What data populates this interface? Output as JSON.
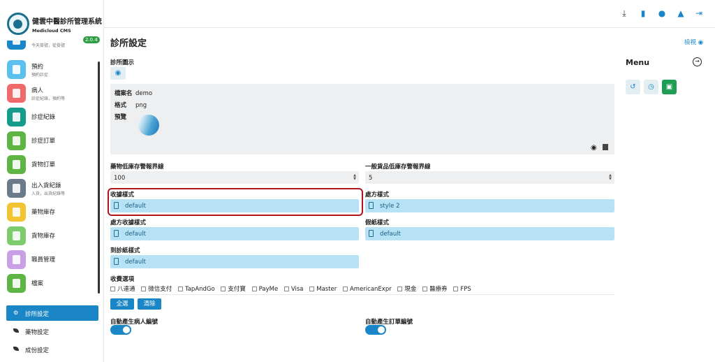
{
  "app": {
    "title": "健雲中醫診所管理系統",
    "subtitle": "Medicloud CMS",
    "version": "2.0.4"
  },
  "sidebar": {
    "items": [
      {
        "label": "",
        "sub": "今天掛號，從掛號",
        "color": "#1b86c7"
      },
      {
        "label": "預約",
        "sub": "預約診症",
        "color": "#5cc0ee"
      },
      {
        "label": "病人",
        "sub": "診症紀錄，預約等",
        "color": "#ef6b6b"
      },
      {
        "label": "診症紀錄",
        "sub": "",
        "color": "#159c8a"
      },
      {
        "label": "診症訂單",
        "sub": "",
        "color": "#5fb544"
      },
      {
        "label": "貨物訂單",
        "sub": "",
        "color": "#5fb544"
      },
      {
        "label": "出入貨紀錄",
        "sub": "入貨，出貨紀錄等",
        "color": "#6b7b8a"
      },
      {
        "label": "藥物庫存",
        "sub": "",
        "color": "#f2c431"
      },
      {
        "label": "貨物庫存",
        "sub": "",
        "color": "#7ccb6c"
      },
      {
        "label": "職員管理",
        "sub": "",
        "color": "#c9a0e6"
      },
      {
        "label": "檔案",
        "sub": "",
        "color": "#5fb544"
      }
    ],
    "settings": [
      {
        "label": "診所設定",
        "icon": "gears-icon"
      },
      {
        "label": "藥物設定",
        "icon": "leaf-icon"
      },
      {
        "label": "成份設定",
        "icon": "leaf-icon"
      }
    ]
  },
  "page": {
    "title": "診所設定",
    "view_link": "檢視"
  },
  "logo_section": {
    "label": "診所圖示",
    "file_name_label": "檔案名",
    "file_name": "demo",
    "format_label": "格式",
    "format": "png",
    "preview_label": "預覽"
  },
  "stock_alert": {
    "medicine_label": "藥物低庫存警報界線",
    "medicine_value": "100",
    "general_label": "一般貨品低庫存警報界線",
    "general_value": "5"
  },
  "styles": {
    "receipt_label": "收據樣式",
    "receipt_value": "default",
    "prescription_label": "處方樣式",
    "prescription_value": "style 2",
    "prescription_receipt_label": "處方收據樣式",
    "prescription_receipt_value": "default",
    "leave_label": "假紙樣式",
    "leave_value": "default",
    "attendance_label": "到診紙樣式",
    "attendance_value": "default"
  },
  "payment": {
    "label": "收費選項",
    "options": [
      "八達通",
      "微信支付",
      "TapAndGo",
      "支付寶",
      "PayMe",
      "Visa",
      "Master",
      "AmericanExpr",
      "現金",
      "醫療券",
      "FPS"
    ],
    "select_all": "全選",
    "clear": "清除"
  },
  "auto_numbering": {
    "patient_label": "自動產生病人編號",
    "patient_on": true,
    "order_label": "自動產生訂單編號",
    "order_on": true
  },
  "right_menu": {
    "title": "Menu"
  }
}
